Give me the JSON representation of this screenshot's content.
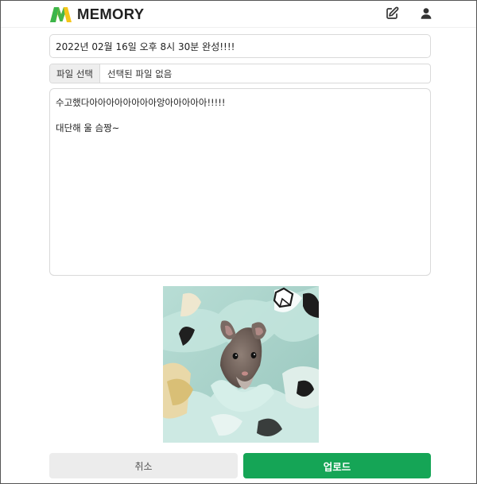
{
  "header": {
    "logo_text": "MEMORY",
    "icons": {
      "write": "edit-square-icon",
      "profile": "user-icon"
    }
  },
  "form": {
    "title_value": "2022년 02월 16일 오후 8시 30분 완성!!!!",
    "file_button_label": "파일 선택",
    "file_status": "선택된 파일 없음",
    "content_value": "수고했다아아아아아아아아앙아아아아아!!!!!\n\n대단해 울 슴짱~",
    "cancel_label": "취소",
    "upload_label": "업로드"
  },
  "colors": {
    "brand_green": "#15a556",
    "logo_yellow": "#f5c518",
    "logo_green": "#3cb54a"
  }
}
